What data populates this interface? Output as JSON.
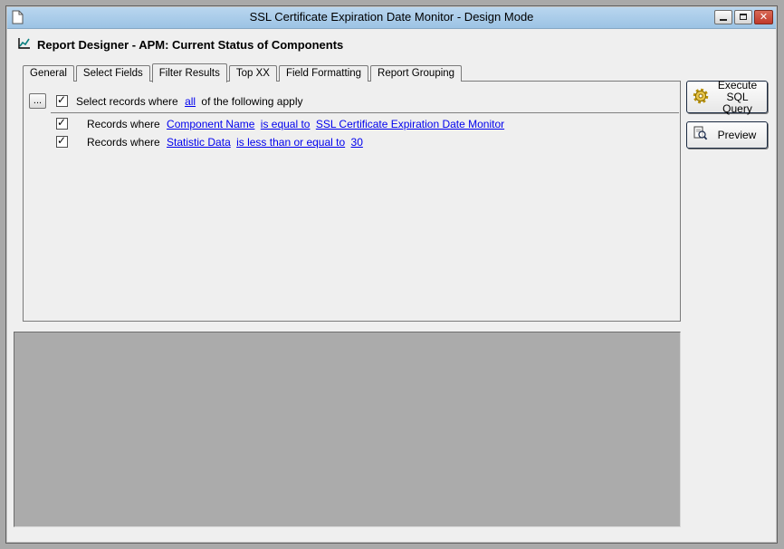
{
  "window": {
    "title": "SSL Certificate Expiration Date Monitor - Design Mode",
    "controls": {
      "minimize": "minimize",
      "maximize": "maximize",
      "close_glyph": "✕"
    }
  },
  "header": {
    "title": "Report Designer - APM: Current Status of Components"
  },
  "tabs": [
    {
      "label": "General",
      "active": false
    },
    {
      "label": "Select Fields",
      "active": false
    },
    {
      "label": "Filter Results",
      "active": true
    },
    {
      "label": "Top XX",
      "active": false
    },
    {
      "label": "Field Formatting",
      "active": false
    },
    {
      "label": "Report Grouping",
      "active": false
    }
  ],
  "filter": {
    "more_button_label": "...",
    "header": {
      "checked": true,
      "prefix": "Select records where",
      "link": "all",
      "suffix": "of the following apply"
    },
    "rules": [
      {
        "checked": true,
        "prefix": "Records where",
        "links": [
          "Component Name",
          "is equal to",
          "SSL Certificate Expiration Date Monitor"
        ]
      },
      {
        "checked": true,
        "prefix": "Records where",
        "links": [
          "Statistic Data",
          "is less than or equal to",
          "30"
        ]
      }
    ]
  },
  "actions": {
    "execute_line1": "Execute",
    "execute_line2": "SQL Query",
    "preview": "Preview"
  },
  "glyphs": {
    "check": "✓"
  },
  "colors": {
    "titlebar": "#A8CCE9",
    "close_button": "#C0392B",
    "link": "#0000EE",
    "preview_panel": "#ABABAB",
    "window_background": "#EFEFEF"
  }
}
